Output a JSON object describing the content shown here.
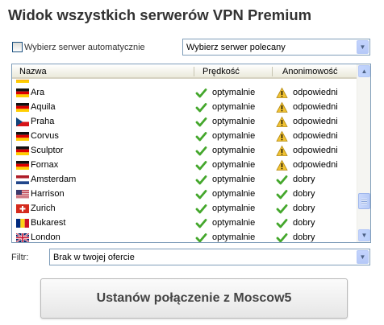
{
  "title": "Widok wszystkich serwerów VPN Premium",
  "auto_select": {
    "label": "Wybierz serwer automatycznie",
    "checked": false
  },
  "recommended_select": {
    "value": "Wybierz serwer polecany"
  },
  "table": {
    "headers": {
      "name": "Nazwa",
      "speed": "Prędkość",
      "anonymity": "Anonimowość"
    },
    "partial_row": {
      "country": "germany",
      "name": "",
      "speed": "",
      "anonymity": ""
    },
    "rows": [
      {
        "country": "germany",
        "name": "Ara",
        "speed": "optymalnie",
        "speed_icon": "check-icon",
        "anonymity": "odpowiedni",
        "anonymity_icon": "warning-icon"
      },
      {
        "country": "germany",
        "name": "Aquila",
        "speed": "optymalnie",
        "speed_icon": "check-icon",
        "anonymity": "odpowiedni",
        "anonymity_icon": "warning-icon"
      },
      {
        "country": "czech",
        "name": "Praha",
        "speed": "optymalnie",
        "speed_icon": "check-icon",
        "anonymity": "odpowiedni",
        "anonymity_icon": "warning-icon"
      },
      {
        "country": "germany",
        "name": "Corvus",
        "speed": "optymalnie",
        "speed_icon": "check-icon",
        "anonymity": "odpowiedni",
        "anonymity_icon": "warning-icon"
      },
      {
        "country": "germany",
        "name": "Sculptor",
        "speed": "optymalnie",
        "speed_icon": "check-icon",
        "anonymity": "odpowiedni",
        "anonymity_icon": "warning-icon"
      },
      {
        "country": "germany",
        "name": "Fornax",
        "speed": "optymalnie",
        "speed_icon": "check-icon",
        "anonymity": "odpowiedni",
        "anonymity_icon": "warning-icon"
      },
      {
        "country": "netherlands",
        "name": "Amsterdam",
        "speed": "optymalnie",
        "speed_icon": "check-icon",
        "anonymity": "dobry",
        "anonymity_icon": "check-icon"
      },
      {
        "country": "usa",
        "name": "Harrison",
        "speed": "optymalnie",
        "speed_icon": "check-icon",
        "anonymity": "dobry",
        "anonymity_icon": "check-icon"
      },
      {
        "country": "switzerland",
        "name": "Zurich",
        "speed": "optymalnie",
        "speed_icon": "check-icon",
        "anonymity": "dobry",
        "anonymity_icon": "check-icon"
      },
      {
        "country": "romania",
        "name": "Bukarest",
        "speed": "optymalnie",
        "speed_icon": "check-icon",
        "anonymity": "dobry",
        "anonymity_icon": "check-icon"
      },
      {
        "country": "uk",
        "name": "London",
        "speed": "optymalnie",
        "speed_icon": "check-icon",
        "anonymity": "dobry",
        "anonymity_icon": "check-icon"
      }
    ]
  },
  "filter": {
    "label": "Filtr:",
    "value": "Brak w twojej ofercie"
  },
  "connect_button": {
    "label": "Ustanów połączenie z Moscow5"
  },
  "colors": {
    "check": "#44a72c",
    "warning": "#f1c232",
    "title": "#333333",
    "border": "#7f9db9"
  }
}
